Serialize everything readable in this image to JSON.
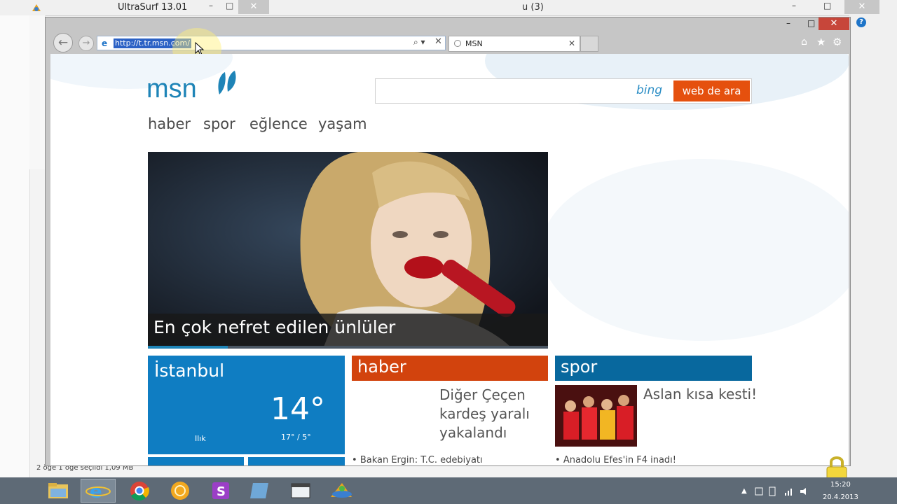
{
  "background_window": {
    "title": "UltraSurf 13.01",
    "min_glyph": "–",
    "max_glyph": "□",
    "close_glyph": "✕",
    "right_title": "u (3)",
    "help_glyph": "?",
    "status_text": "2 öğe    1 öğe seçildi  1,09 MB"
  },
  "ie": {
    "close_glyph": "✕",
    "back_glyph": "←",
    "forward_glyph": "→",
    "address_url": "http://t.tr.msn.com/",
    "search_glyph": "⌕ ▾",
    "stop_glyph": "✕",
    "tab_label": "MSN",
    "tab_close": "✕",
    "home_glyph": "⌂",
    "favorites_glyph": "★",
    "tools_glyph": "⚙"
  },
  "msn": {
    "brand": "msn",
    "bing_label": "bing",
    "search_button": "web de ara",
    "nav": [
      "haber",
      "spor",
      "eğlence",
      "yaşam"
    ],
    "hero_caption": "En çok nefret edilen ünlüler",
    "weather": {
      "city": "İstanbul",
      "temp": "14°",
      "condition": "Ilık",
      "range": "17° / 5°"
    },
    "haber": {
      "title": "haber",
      "story": "Diğer Çeçen kardeş yaralı yakalandı",
      "bullet": "Bakan Ergin: T.C. edebiyatı"
    },
    "spor": {
      "title": "spor",
      "story": "Aslan kısa kesti!",
      "bullet": "Anadolu Efes'in F4 inadı!"
    }
  },
  "taskbar": {
    "time": "15:20",
    "date": "20.4.2013",
    "tray_arrow": "▲"
  },
  "colors": {
    "msn_blue": "#1e84b7",
    "orange": "#e5500e",
    "haber_red": "#d2430d",
    "spor_blue": "#08689e",
    "weather_blue": "#0f7dc2"
  }
}
